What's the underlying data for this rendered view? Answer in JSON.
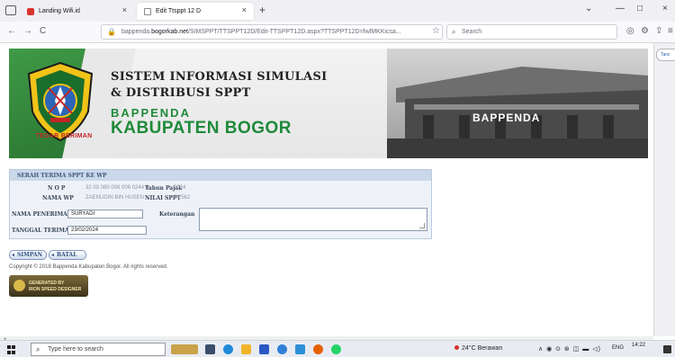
{
  "browser": {
    "tabs": [
      {
        "label": "Landing Wifi.id",
        "close": "×"
      },
      {
        "label": "Edit Ttsppt 12 D",
        "close": "×"
      }
    ],
    "new_tab": "+",
    "window_controls": {
      "list": "⌄",
      "minimize": "—",
      "maximize": "□",
      "close": "×"
    },
    "nav": {
      "back": "←",
      "forward": "→",
      "reload": "C"
    },
    "url_prefix": "bappenda.",
    "url_domain": "bogorkab.net",
    "url_path": "/SIMSPPT/TTSPPT12D/Edit-TTSPPT12D.aspx?TTSPPT12D=fwlMKKicsa...",
    "bookmark_star": "☆",
    "search_placeholder": "Search",
    "toolbar_icons": {
      "pocket": "◎",
      "account": "⚙",
      "extensions": "⇪",
      "menu": "≡"
    },
    "sidebar_tab_label": "Tanc"
  },
  "header": {
    "title_line1": "SISTEM INFORMASI SIMULASI",
    "title_line2": "& DISTRIBUSI SPPT",
    "title_line3": "BAPPENDA",
    "title_line4": "KABUPATEN BOGOR",
    "building_label": "BAPPENDA",
    "motto": "TEGAR BERIMAN"
  },
  "form": {
    "panel_title": "SERAH TERIMA SPPT KE WP",
    "nop_label": "N O P",
    "nop_value": "32 03 080 006 006 0244 0",
    "nama_wp_label": "NAMA WP",
    "nama_wp_value": "ZAENUDIN BIN HUSEN",
    "tahun_pajak_label": "Tahun Pajak",
    "tahun_pajak_value": "2024",
    "nilai_sppt_label": "NILAI SPPT",
    "nilai_sppt_value": "64.562",
    "nama_penerima_label": "NAMA PENERIMA",
    "nama_penerima_value": "SURYADI",
    "keterangan_label": "Keterangan",
    "tanggal_terima_label": "TANGGAL TERIMA",
    "tanggal_terima_value": "23/02/2024"
  },
  "buttons": {
    "save": "SIMPAN",
    "cancel": "BATAL"
  },
  "footer": {
    "copyright": "Copyright © 2018 Bappenda Kabupaten Bogor. All rights reserved.",
    "badge_line1": "GENERATED BY",
    "badge_line2": "IRON SPEED DESIGNER"
  },
  "taskbar": {
    "search_placeholder": "Type here to search",
    "weather": "24°C  Berawan",
    "tray_icons": "∧ ◉ ⊙ ⊛ ◫ ▬ ◁)",
    "language": "ENG",
    "time": "14:22"
  },
  "colors": {
    "brand_green": "#1f8a3a",
    "panel_header": "#cad8ea",
    "button_text": "#2d4f86"
  }
}
